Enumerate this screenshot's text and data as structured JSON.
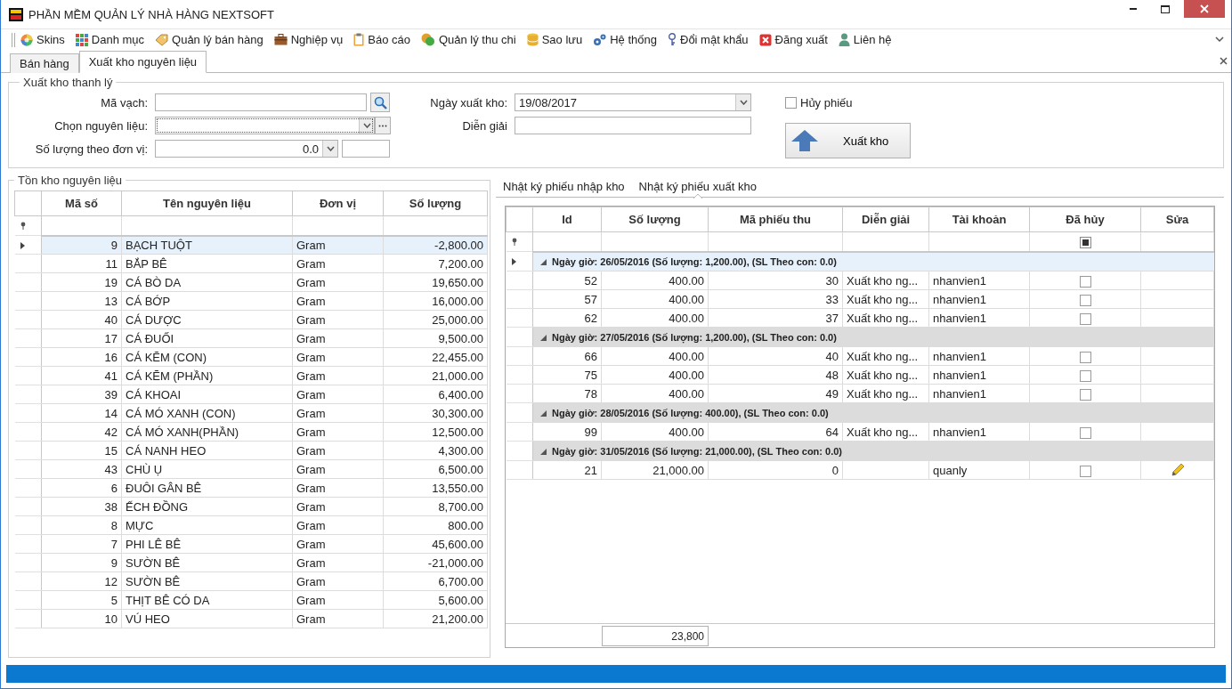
{
  "window": {
    "title": "PHẦN MỀM QUẢN LÝ NHÀ HÀNG NEXTSOFT"
  },
  "menu": [
    "Skins",
    "Danh mục",
    "Quản lý bán hàng",
    "Nghiệp vụ",
    "Báo cáo",
    "Quản lý thu chi",
    "Sao lưu",
    "Hệ thống",
    "Đổi mật khẩu",
    "Đăng xuất",
    "Liên hệ"
  ],
  "tabs": [
    {
      "label": "Bán hàng",
      "selected": false
    },
    {
      "label": "Xuất kho nguyên liệu",
      "selected": true
    }
  ],
  "form": {
    "title": "Xuất kho thanh lý",
    "barcode": {
      "label": "Mã vạch:"
    },
    "ingredient": {
      "label": "Chọn nguyên liệu:"
    },
    "quantity": {
      "label": "Số lượng theo đơn vị:",
      "value": "0.0"
    },
    "date": {
      "label": "Ngày xuất kho:",
      "value": "19/08/2017"
    },
    "note": {
      "label": "Diễn giải"
    },
    "cancel": {
      "label": "Hủy phiếu",
      "checked": false
    },
    "submit": "Xuất kho"
  },
  "stock": {
    "title": "Tồn kho nguyên liệu",
    "columns": [
      "Mã số",
      "Tên nguyên liệu",
      "Đơn vị",
      "Số lượng"
    ],
    "rows": [
      {
        "cells": [
          "9",
          "BẠCH TUỘT",
          "Gram",
          "-2,800.00"
        ],
        "selected": true
      },
      {
        "cells": [
          "11",
          "BẮP BÊ",
          "Gram",
          "7,200.00"
        ],
        "selected": false
      },
      {
        "cells": [
          "19",
          "CÁ BÒ DA",
          "Gram",
          "19,650.00"
        ],
        "selected": false
      },
      {
        "cells": [
          "13",
          "CÁ BỚP",
          "Gram",
          "16,000.00"
        ],
        "selected": false
      },
      {
        "cells": [
          "40",
          "CÁ DƯỢC",
          "Gram",
          "25,000.00"
        ],
        "selected": false
      },
      {
        "cells": [
          "17",
          "CÁ ĐUỐI",
          "Gram",
          "9,500.00"
        ],
        "selected": false
      },
      {
        "cells": [
          "16",
          "CÁ KẼM (CON)",
          "Gram",
          "22,455.00"
        ],
        "selected": false
      },
      {
        "cells": [
          "41",
          "CÁ KẼM (PHẦN)",
          "Gram",
          "21,000.00"
        ],
        "selected": false
      },
      {
        "cells": [
          "39",
          "CÁ KHOAI",
          "Gram",
          "6,400.00"
        ],
        "selected": false
      },
      {
        "cells": [
          "14",
          "CÁ MÓ XANH (CON)",
          "Gram",
          "30,300.00"
        ],
        "selected": false
      },
      {
        "cells": [
          "42",
          "CÁ MÓ XANH(PHẦN)",
          "Gram",
          "12,500.00"
        ],
        "selected": false
      },
      {
        "cells": [
          "15",
          "CÁ NANH HEO",
          "Gram",
          "4,300.00"
        ],
        "selected": false
      },
      {
        "cells": [
          "43",
          "CHÙ Ụ",
          "Gram",
          "6,500.00"
        ],
        "selected": false
      },
      {
        "cells": [
          "6",
          "ĐUÔI GÂN BÊ",
          "Gram",
          "13,550.00"
        ],
        "selected": false
      },
      {
        "cells": [
          "38",
          "ẾCH ĐỒNG",
          "Gram",
          "8,700.00"
        ],
        "selected": false
      },
      {
        "cells": [
          "8",
          "MỰC",
          "Gram",
          "800.00"
        ],
        "selected": false
      },
      {
        "cells": [
          "7",
          "PHI LÊ BÊ",
          "Gram",
          "45,600.00"
        ],
        "selected": false
      },
      {
        "cells": [
          "9",
          "SƯỜN BÊ",
          "Gram",
          "-21,000.00"
        ],
        "selected": false
      },
      {
        "cells": [
          "12",
          "SƯỜN BÊ",
          "Gram",
          "6,700.00"
        ],
        "selected": false
      },
      {
        "cells": [
          "5",
          "THỊT BÊ CÓ DA",
          "Gram",
          "5,600.00"
        ],
        "selected": false
      },
      {
        "cells": [
          "10",
          "VÚ HEO",
          "Gram",
          "21,200.00"
        ],
        "selected": false
      }
    ]
  },
  "log_tabs": [
    {
      "label": "Nhật ký phiếu nhập kho",
      "selected": false
    },
    {
      "label": "Nhật ký phiếu xuất kho",
      "selected": true
    }
  ],
  "log": {
    "columns": [
      "Id",
      "Số lượng",
      "Mã phiếu thu",
      "Diễn giải",
      "Tài khoản",
      "Đã hủy",
      "Sửa"
    ],
    "cancel_filter_indeterminate": true,
    "groups": [
      {
        "label": "Ngày giờ: 26/05/2016 (Số lượng: 1,200.00), (SL Theo con: 0.0)",
        "selected": true,
        "expanded": true,
        "rows": [
          {
            "cells": [
              "52",
              "400.00",
              "30",
              "Xuất kho ng...",
              "nhanvien1"
            ],
            "cancelled": false,
            "editable": false
          },
          {
            "cells": [
              "57",
              "400.00",
              "33",
              "Xuất kho ng...",
              "nhanvien1"
            ],
            "cancelled": false,
            "editable": false
          },
          {
            "cells": [
              "62",
              "400.00",
              "37",
              "Xuất kho ng...",
              "nhanvien1"
            ],
            "cancelled": false,
            "editable": false
          }
        ]
      },
      {
        "label": "Ngày giờ: 27/05/2016 (Số lượng: 1,200.00), (SL Theo con: 0.0)",
        "selected": false,
        "expanded": true,
        "rows": [
          {
            "cells": [
              "66",
              "400.00",
              "40",
              "Xuất kho ng...",
              "nhanvien1"
            ],
            "cancelled": false,
            "editable": false
          },
          {
            "cells": [
              "75",
              "400.00",
              "48",
              "Xuất kho ng...",
              "nhanvien1"
            ],
            "cancelled": false,
            "editable": false
          },
          {
            "cells": [
              "78",
              "400.00",
              "49",
              "Xuất kho ng...",
              "nhanvien1"
            ],
            "cancelled": false,
            "editable": false
          }
        ]
      },
      {
        "label": "Ngày giờ: 28/05/2016 (Số lượng: 400.00), (SL Theo con: 0.0)",
        "selected": false,
        "expanded": true,
        "rows": [
          {
            "cells": [
              "99",
              "400.00",
              "64",
              "Xuất kho ng...",
              "nhanvien1"
            ],
            "cancelled": false,
            "editable": false
          }
        ]
      },
      {
        "label": "Ngày giờ: 31/05/2016 (Số lượng: 21,000.00), (SL Theo con: 0.0)",
        "selected": false,
        "expanded": true,
        "rows": [
          {
            "cells": [
              "21",
              "21,000.00",
              "0",
              null,
              "quanly"
            ],
            "cancelled": false,
            "editable": true
          }
        ]
      }
    ],
    "total": "23,800"
  }
}
